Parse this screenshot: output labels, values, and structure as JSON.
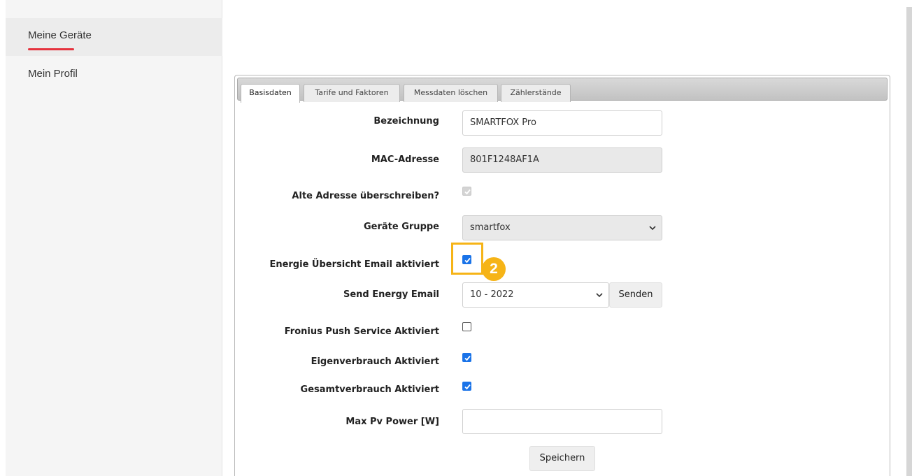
{
  "sidebar": {
    "items": [
      {
        "label": "Meine Geräte",
        "active": true
      },
      {
        "label": "Mein Profil",
        "active": false
      }
    ]
  },
  "tabs": [
    {
      "label": "Basisdaten",
      "active": true
    },
    {
      "label": "Tarife und Faktoren",
      "active": false
    },
    {
      "label": "Messdaten löschen",
      "active": false
    },
    {
      "label": "Zählerstände",
      "active": false
    }
  ],
  "form": {
    "bezeichnung": {
      "label": "Bezeichnung",
      "value": "SMARTFOX Pro"
    },
    "mac": {
      "label": "MAC-Adresse",
      "value": "801F1248AF1A"
    },
    "alte_adresse": {
      "label": "Alte Adresse überschreiben?",
      "checked": true,
      "disabled": true
    },
    "geraete_gruppe": {
      "label": "Geräte Gruppe",
      "value": "smartfox"
    },
    "energie_email": {
      "label": "Energie Übersicht Email aktiviert",
      "checked": true
    },
    "send_energy": {
      "label": "Send Energy Email",
      "value": "10 - 2022",
      "button": "Senden"
    },
    "fronius": {
      "label": "Fronius Push Service Aktiviert",
      "checked": false
    },
    "eigenverbrauch": {
      "label": "Eigenverbrauch Aktiviert",
      "checked": true
    },
    "gesamtverbrauch": {
      "label": "Gesamtverbrauch Aktiviert",
      "checked": true
    },
    "max_pv": {
      "label": "Max Pv Power [W]",
      "value": ""
    },
    "save_label": "Speichern"
  },
  "annotation": {
    "step": "2",
    "color": "#f6b417"
  },
  "colors": {
    "accent": "#e5323d",
    "checkbox": "#1a73e8"
  }
}
